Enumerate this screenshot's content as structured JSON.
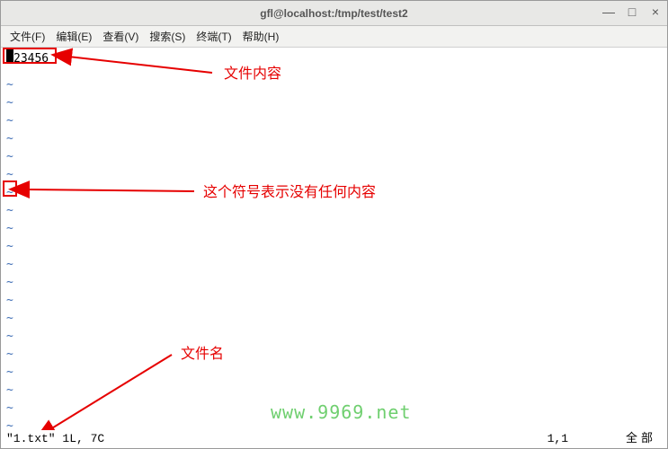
{
  "titlebar": {
    "title": "gfl@localhost:/tmp/test/test2",
    "minimize": "—",
    "maximize": "□",
    "close": "×"
  },
  "menu": {
    "file": "文件(F)",
    "edit": "编辑(E)",
    "view": "查看(V)",
    "search": "搜索(S)",
    "terminal": "终端(T)",
    "help": "帮助(H)"
  },
  "editor": {
    "content_line": "23456",
    "tilde": "~"
  },
  "status": {
    "filename": "\"1.txt\"",
    "info": " 1L, 7C",
    "position": "1,1",
    "percent": "全部"
  },
  "annotations": {
    "content_label": "文件内容",
    "tilde_label": "这个符号表示没有任何内容",
    "filename_label": "文件名"
  },
  "watermark": "www.9969.net"
}
